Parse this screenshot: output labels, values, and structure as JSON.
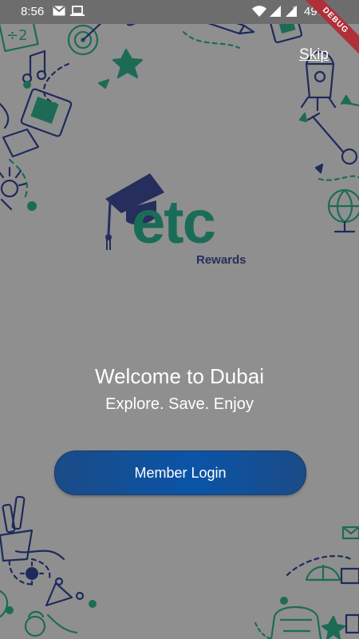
{
  "status_bar": {
    "time": "8:56",
    "battery": "49%",
    "debug_label": "DEBUG"
  },
  "header": {
    "skip_label": "Skip"
  },
  "logo": {
    "wordmark": "etc",
    "subtitle": "Rewards"
  },
  "welcome": {
    "title": "Welcome to Dubai",
    "tagline": "Explore. Save. Enjoy"
  },
  "actions": {
    "login_label": "Member Login"
  },
  "colors": {
    "background": "#8f8f8f",
    "status_bar": "#6d6d6d",
    "brand_green": "#1a6c58",
    "brand_navy": "#262e5e",
    "button_blue": "#0a54a8",
    "doodle_green": "#1d6b55",
    "doodle_navy": "#1e2a5c"
  }
}
